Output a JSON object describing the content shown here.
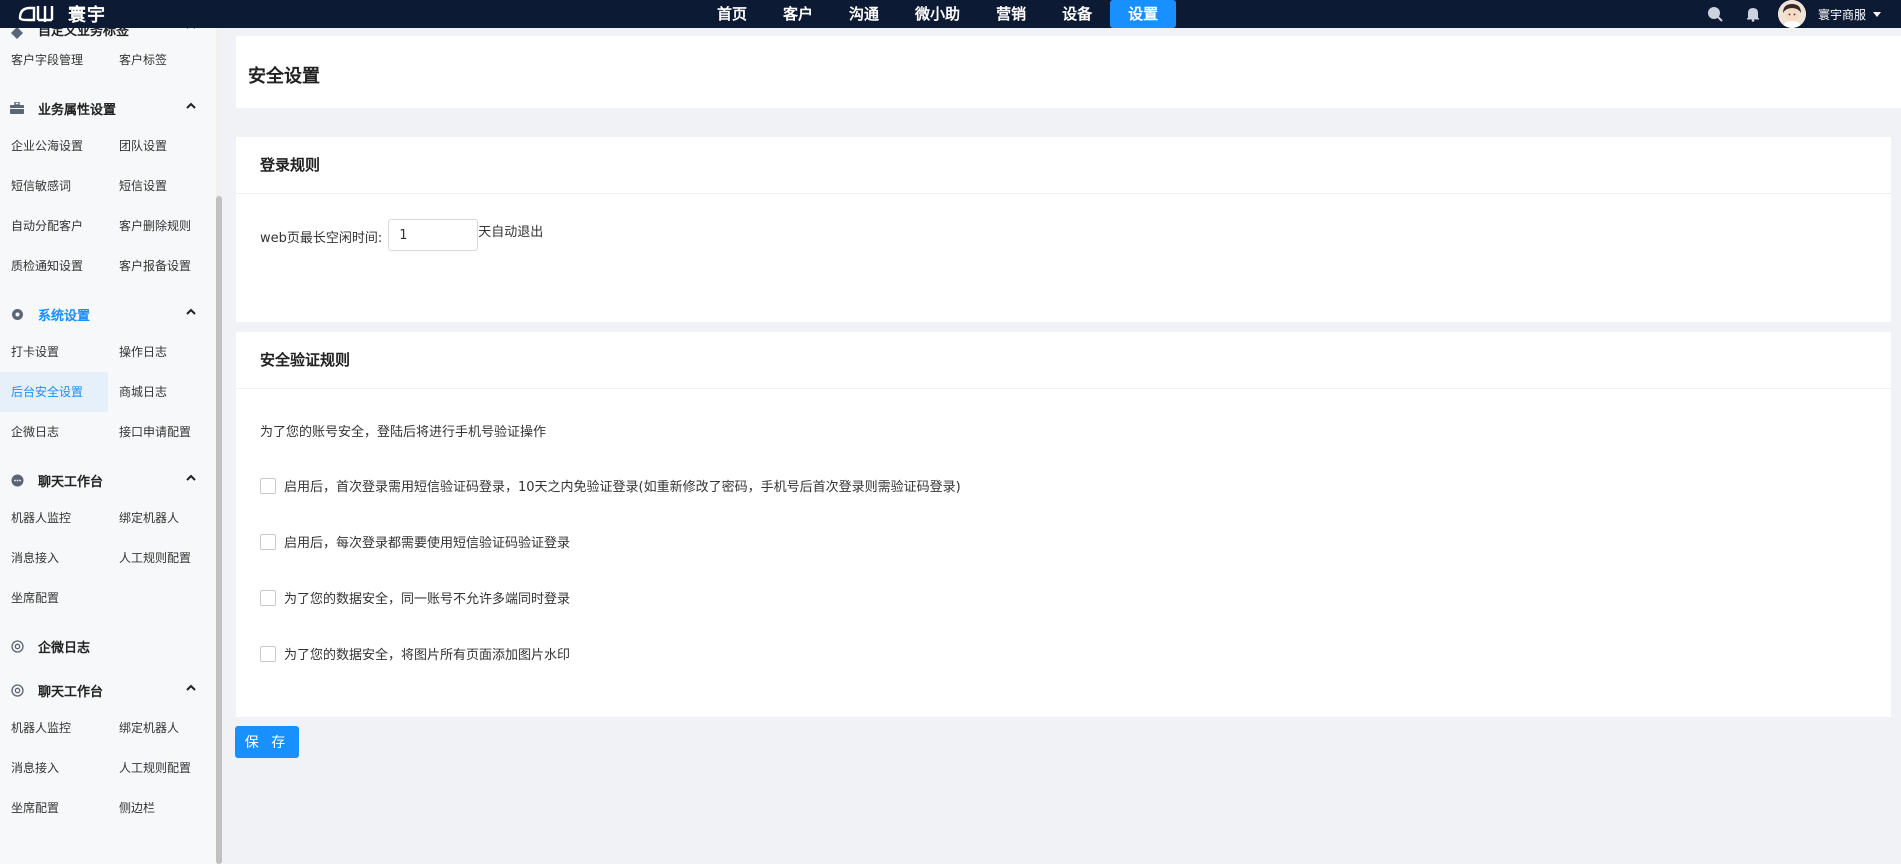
{
  "app": {
    "brand": "寰宇",
    "logo_mark": "ЧЏ"
  },
  "nav": {
    "items": [
      "首页",
      "客户",
      "沟通",
      "微小助",
      "营销",
      "设备",
      "设置"
    ],
    "active": "设置"
  },
  "topbar": {
    "user_name": "寰宇商服",
    "icons": [
      "search-icon",
      "bell-icon",
      "avatar"
    ]
  },
  "sidebar": {
    "partial_group_label": "自定义业务标签",
    "partial_items": [
      "客户字段管理",
      "客户标签"
    ],
    "groups": [
      {
        "label": "业务属性设置",
        "icon": "briefcase-icon",
        "items": [
          "企业公海设置",
          "团队设置",
          "短信敏感词",
          "短信设置",
          "自动分配客户",
          "客户删除规则",
          "质检通知设置",
          "客户报备设置"
        ]
      },
      {
        "label": "系统设置",
        "icon": "gear-icon",
        "items": [
          "打卡设置",
          "操作日志",
          "后台安全设置",
          "商城日志",
          "企微日志",
          "接口申请配置"
        ]
      },
      {
        "label": "聊天工作台",
        "icon": "chat-icon",
        "items": [
          "机器人监控",
          "绑定机器人",
          "消息接入",
          "人工规则配置",
          "坐席配置"
        ]
      },
      {
        "label": "企微日志",
        "icon": "circle-icon",
        "items": []
      },
      {
        "label": "聊天工作台",
        "icon": "circle-icon",
        "items": [
          "机器人监控",
          "绑定机器人",
          "消息接入",
          "人工规则配置",
          "坐席配置",
          "侧边栏"
        ]
      }
    ],
    "active_item": "后台安全设置"
  },
  "page": {
    "title": "安全设置"
  },
  "login_rules": {
    "title": "登录规则",
    "idle_label": "web页最长空闲时间:",
    "idle_value": "1",
    "idle_suffix": "天自动退出"
  },
  "security_rules": {
    "title": "安全验证规则",
    "intro": "为了您的账号安全，登陆后将进行手机号验证操作",
    "options": [
      {
        "label": "启用后，首次登录需用短信验证码登录，10天之内免验证登录(如重新修改了密码，手机号后首次登录则需验证码登录)",
        "checked": false
      },
      {
        "label": "启用后，每次登录都需要使用短信验证码验证登录",
        "checked": false
      },
      {
        "label": "为了您的数据安全，同一账号不允许多端同时登录",
        "checked": false
      },
      {
        "label": "为了您的数据安全，将图片所有页面添加图片水印",
        "checked": false
      }
    ]
  },
  "actions": {
    "save": "保 存"
  },
  "colors": {
    "topbar_bg": "#0c1a33",
    "accent": "#1890ff",
    "page_bg": "#f0f2f5",
    "sidebar_bg": "#f7f8f9",
    "active_item_bg": "#e6f0fb"
  }
}
